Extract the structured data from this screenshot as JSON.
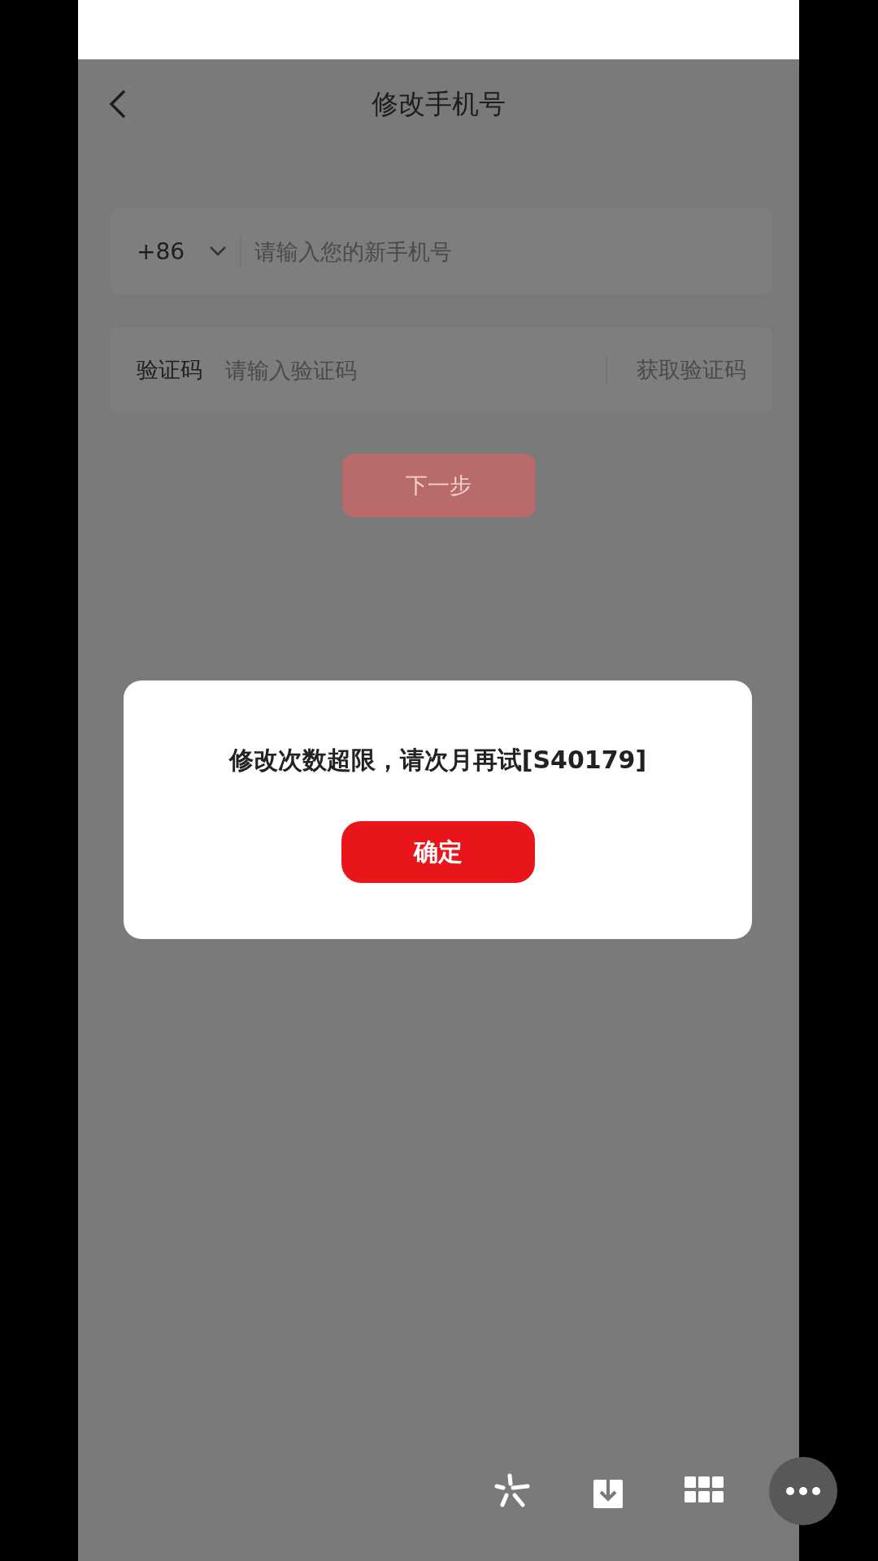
{
  "header": {
    "title": "修改手机号"
  },
  "phone_field": {
    "country_code": "+86",
    "placeholder": "请输入您的新手机号"
  },
  "code_field": {
    "label": "验证码",
    "placeholder": "请输入验证码",
    "get_code_button": "获取验证码"
  },
  "next_button": {
    "label": "下一步",
    "disabled": true
  },
  "dialog": {
    "message": "修改次数超限，请次月再试[S40179]",
    "confirm_button": "确定"
  }
}
